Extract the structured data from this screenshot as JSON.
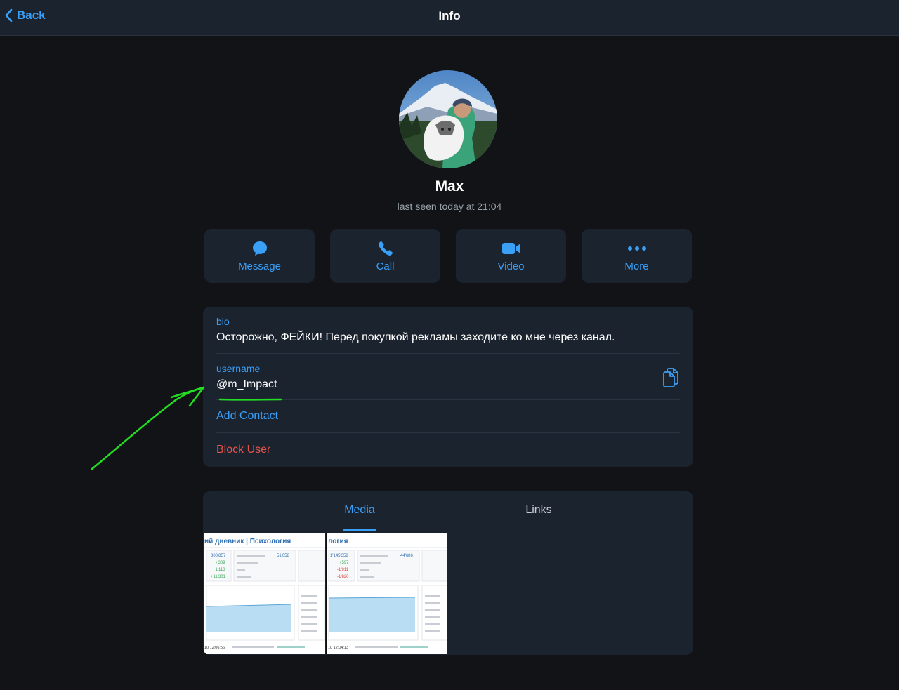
{
  "header": {
    "back_label": "Back",
    "title": "Info"
  },
  "profile": {
    "name": "Max",
    "status": "last seen today at 21:04"
  },
  "actions": [
    {
      "label": "Message",
      "icon": "chat-bubble-icon"
    },
    {
      "label": "Call",
      "icon": "phone-icon"
    },
    {
      "label": "Video",
      "icon": "video-camera-icon"
    },
    {
      "label": "More",
      "icon": "more-dots-icon"
    }
  ],
  "info": {
    "bio_label": "bio",
    "bio_value": "Осторожно, ФЕЙКИ! Перед покупкой рекламы заходите ко мне через канал.",
    "username_label": "username",
    "username_value": "@m_Impact",
    "add_contact": "Add Contact",
    "block_user": "Block User"
  },
  "media": {
    "tabs": [
      "Media",
      "Links"
    ],
    "active_tab": "Media",
    "thumbnails": [
      {
        "title": "ий дневник | Психология",
        "stats": [
          "300'857",
          "+309",
          "+1'113",
          "+11'301"
        ],
        "views": "51'058",
        "footer": "10 12:06:56"
      },
      {
        "title": "логия",
        "stats": [
          "1'145'358",
          "+597",
          "-1'911",
          "-1'820"
        ],
        "views": "44'686",
        "footer": "10 12:04:13"
      }
    ]
  },
  "colors": {
    "accent": "#3a9ff6",
    "danger": "#e5534b",
    "background": "#121316",
    "card": "#1b232f",
    "annotation": "#22dd22"
  }
}
